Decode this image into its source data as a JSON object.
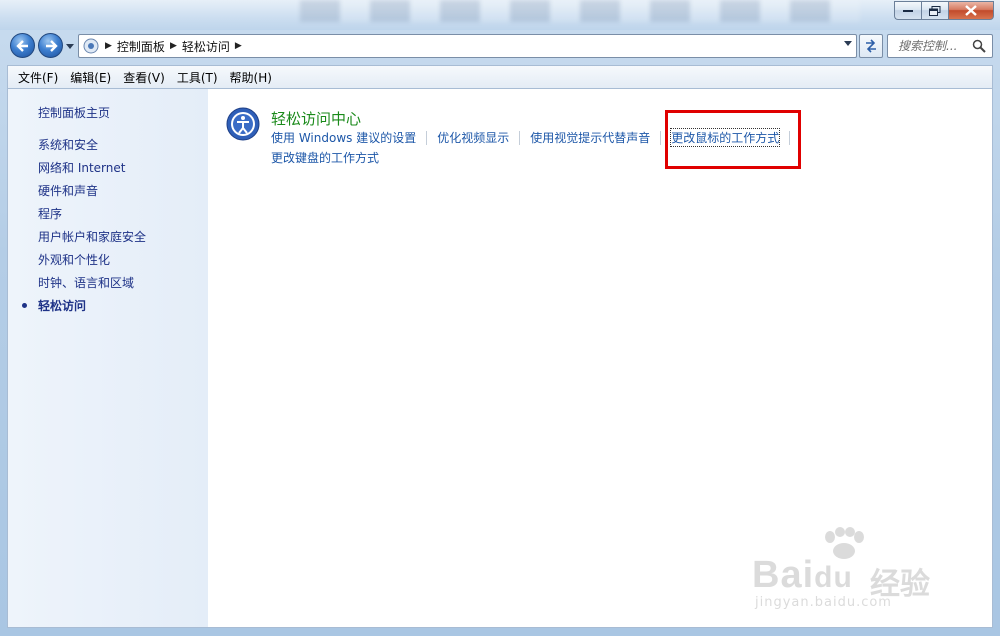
{
  "window": {
    "controls": [
      "minimize",
      "maximize",
      "close"
    ]
  },
  "address": {
    "crumbs": [
      "控制面板",
      "轻松访问"
    ],
    "search_placeholder": "搜索控制..."
  },
  "menubar": {
    "items": [
      "文件(F)",
      "编辑(E)",
      "查看(V)",
      "工具(T)",
      "帮助(H)"
    ]
  },
  "sidebar": {
    "home": "控制面板主页",
    "items": [
      "系统和安全",
      "网络和 Internet",
      "硬件和声音",
      "程序",
      "用户帐户和家庭安全",
      "外观和个性化",
      "时钟、语言和区域",
      "轻松访问"
    ]
  },
  "main": {
    "category_title": "轻松访问中心",
    "links": [
      "使用 Windows 建议的设置",
      "优化视频显示",
      "使用视觉提示代替声音",
      "更改鼠标的工作方式"
    ],
    "link_row2": "更改键盘的工作方式"
  },
  "watermark": {
    "brand": "Bai",
    "brand2": "du",
    "cn": "经验",
    "url": "jingyan.baidu.com"
  },
  "colors": {
    "highlight": "#e00000",
    "link": "#1d57a8",
    "category_title": "#1a8a1a"
  }
}
